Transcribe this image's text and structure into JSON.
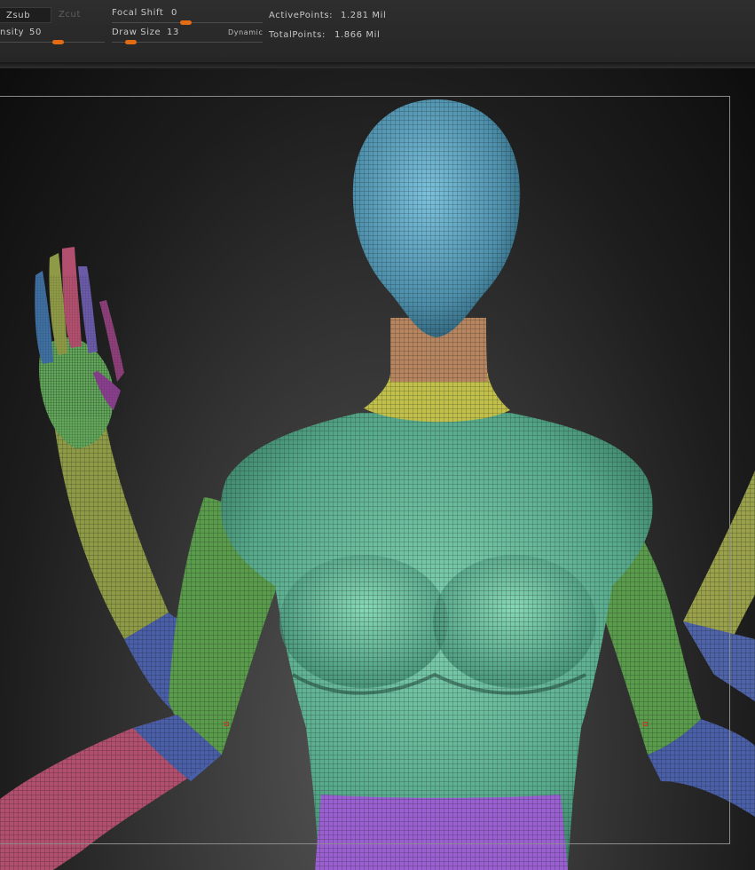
{
  "toolbar": {
    "zsub_label": "Zsub",
    "zcut_label": "Zcut",
    "intensity_label": "nsity",
    "intensity_value": "50",
    "focal_shift_label": "Focal Shift",
    "focal_shift_value": "0",
    "draw_size_label": "Draw Size",
    "draw_size_value": "13",
    "dynamic_label": "Dynamic",
    "active_points_label": "ActivePoints:",
    "active_points_value": "1.281 Mil",
    "total_points_label": "TotalPoints:",
    "total_points_value": "1.866 Mil",
    "accent_color": "#e36b14"
  },
  "viewport": {
    "model": "female-base-mesh-polygroups",
    "polygroup_colors": {
      "head": "#5fa3c0",
      "neck": "#b7855f",
      "collar": "#c2c04a",
      "torso": "#64b79a",
      "upper_arm": "#5a9b4c",
      "elbow": "#4a5fa8",
      "forearm": "#b24f6e",
      "waist": "#9a5fd0",
      "hand": "#63a85a"
    }
  }
}
